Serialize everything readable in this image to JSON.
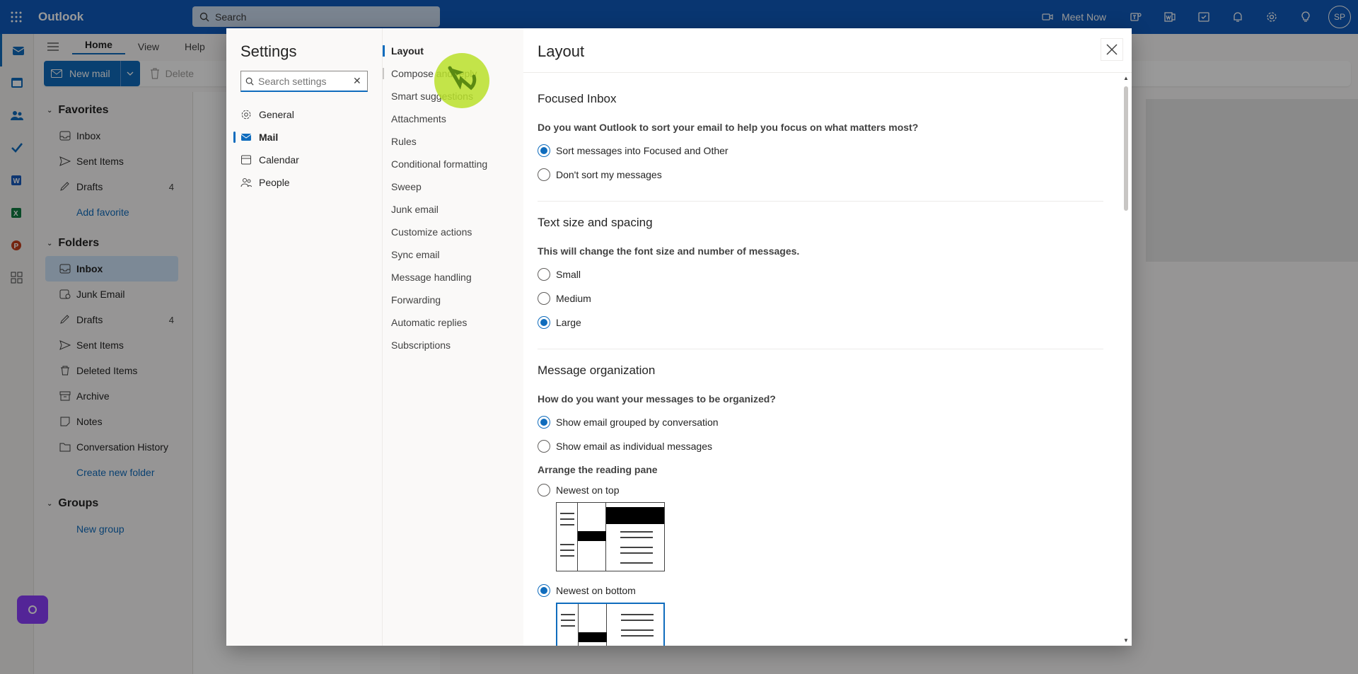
{
  "app": {
    "name": "Outlook",
    "search_placeholder": "Search",
    "meet_now": "Meet Now",
    "avatar_initials": "SP"
  },
  "ribbon": {
    "tabs": [
      "Home",
      "View",
      "Help"
    ],
    "new_mail": "New mail",
    "delete": "Delete"
  },
  "folders": {
    "favorites_header": "Favorites",
    "favorites": [
      {
        "label": "Inbox",
        "count": ""
      },
      {
        "label": "Sent Items",
        "count": ""
      },
      {
        "label": "Drafts",
        "count": "4"
      }
    ],
    "add_favorite": "Add favorite",
    "folders_header": "Folders",
    "items": [
      {
        "label": "Inbox",
        "count": ""
      },
      {
        "label": "Junk Email",
        "count": ""
      },
      {
        "label": "Drafts",
        "count": "4"
      },
      {
        "label": "Sent Items",
        "count": ""
      },
      {
        "label": "Deleted Items",
        "count": ""
      },
      {
        "label": "Archive",
        "count": ""
      },
      {
        "label": "Notes",
        "count": ""
      },
      {
        "label": "Conversation History",
        "count": ""
      }
    ],
    "create_folder": "Create new folder",
    "groups_header": "Groups",
    "new_group": "New group"
  },
  "settings": {
    "title": "Settings",
    "search_placeholder": "Search settings",
    "nav": [
      "General",
      "Mail",
      "Calendar",
      "People"
    ],
    "sub_nav": [
      "Layout",
      "Compose and reply",
      "Smart suggestions",
      "Attachments",
      "Rules",
      "Conditional formatting",
      "Sweep",
      "Junk email",
      "Customize actions",
      "Sync email",
      "Message handling",
      "Forwarding",
      "Automatic replies",
      "Subscriptions"
    ],
    "content_title": "Layout",
    "focused": {
      "title": "Focused Inbox",
      "question": "Do you want Outlook to sort your email to help you focus on what matters most?",
      "opt1": "Sort messages into Focused and Other",
      "opt2": "Don't sort my messages"
    },
    "text_size": {
      "title": "Text size and spacing",
      "question": "This will change the font size and number of messages.",
      "opt1": "Small",
      "opt2": "Medium",
      "opt3": "Large"
    },
    "organization": {
      "title": "Message organization",
      "question": "How do you want your messages to be organized?",
      "opt1": "Show email grouped by conversation",
      "opt2": "Show email as individual messages",
      "reading_pane": "Arrange the reading pane",
      "rp1": "Newest on top",
      "rp2": "Newest on bottom"
    }
  },
  "colors": {
    "brand": "#0f5bbd",
    "accent": "#0f6cbd",
    "cursor": "#b8e12a"
  }
}
